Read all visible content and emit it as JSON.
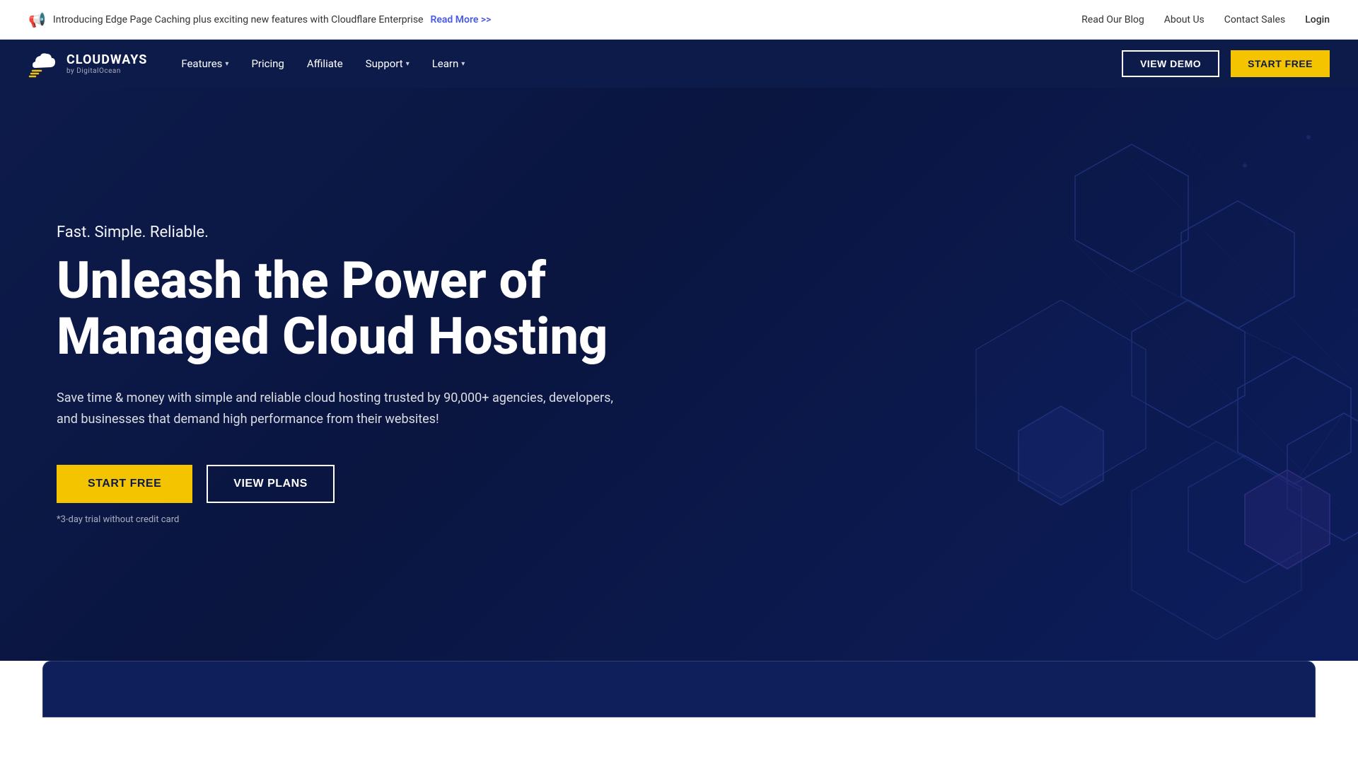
{
  "topbar": {
    "announcement": "Introducing Edge Page Caching plus exciting new features with Cloudflare Enterprise",
    "read_more": "Read More >>",
    "links": [
      {
        "label": "Read Our Blog",
        "key": "read-our-blog"
      },
      {
        "label": "About Us",
        "key": "about-us"
      },
      {
        "label": "Contact Sales",
        "key": "contact-sales"
      },
      {
        "label": "Login",
        "key": "login"
      }
    ]
  },
  "nav": {
    "logo_name": "CLOUDWAYS",
    "logo_sub": "by DigitalOcean",
    "items": [
      {
        "label": "Features",
        "has_dropdown": true,
        "key": "features"
      },
      {
        "label": "Pricing",
        "has_dropdown": false,
        "key": "pricing"
      },
      {
        "label": "Affiliate",
        "has_dropdown": false,
        "key": "affiliate"
      },
      {
        "label": "Support",
        "has_dropdown": true,
        "key": "support"
      },
      {
        "label": "Learn",
        "has_dropdown": true,
        "key": "learn"
      }
    ],
    "view_demo": "VIEW DEMO",
    "start_free": "START FREE"
  },
  "hero": {
    "tagline": "Fast. Simple. Reliable.",
    "title_line1": "Unleash the Power of",
    "title_line2": "Managed Cloud Hosting",
    "description": "Save time & money with simple and reliable cloud hosting trusted by 90,000+ agencies, developers, and businesses that demand high performance from their websites!",
    "btn_start_free": "START FREE",
    "btn_view_plans": "VIEW PLANS",
    "trial_note": "*3-day trial without credit card"
  },
  "colors": {
    "brand_dark": "#0d1b4b",
    "brand_yellow": "#f5c400",
    "white": "#ffffff"
  }
}
